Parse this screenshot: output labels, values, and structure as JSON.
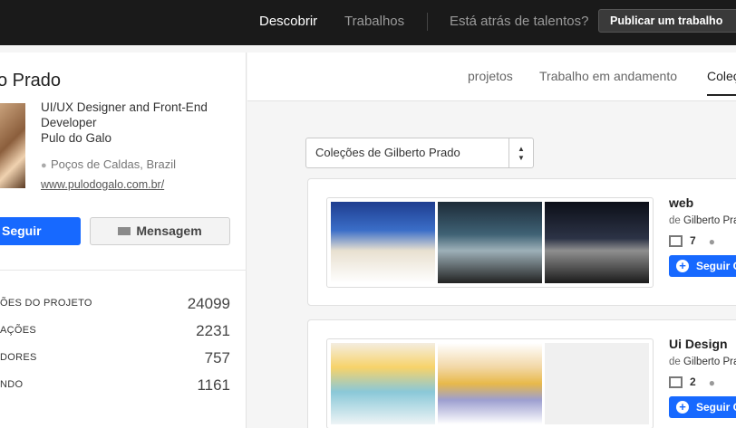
{
  "topbar": {
    "discover": "Descobrir",
    "jobs": "Trabalhos",
    "talent_prompt": "Está atrás de talentos?",
    "publish_job": "Publicar um trabalho"
  },
  "profile": {
    "name": "o Prado",
    "role": "UI/UX Designer and Front-End Developer",
    "company": "Pulo do Galo",
    "location": "Poços de Caldas, Brazil",
    "website": "www.pulodogalo.com.br/",
    "follow_label": "Seguir",
    "message_label": "Mensagem",
    "stats": [
      {
        "label": "ÕES DO PROJETO",
        "value": "24099"
      },
      {
        "label": "AÇÕES",
        "value": "2231"
      },
      {
        "label": "DORES",
        "value": "757"
      },
      {
        "label": "NDO",
        "value": "1161"
      }
    ]
  },
  "tabs": [
    {
      "label": "projetos",
      "active": false
    },
    {
      "label": "Trabalho em andamento",
      "active": false
    },
    {
      "label": "Coleções",
      "active": true
    }
  ],
  "collection_select": {
    "value": "Coleções de Gilberto Prado"
  },
  "collections": [
    {
      "title": "web",
      "by_prefix": "de",
      "by_author": "Gilberto Prado",
      "project_count": "7",
      "follow_label": "Seguir Coleção"
    },
    {
      "title": "Ui Design",
      "by_prefix": "de",
      "by_author": "Gilberto Prado",
      "project_count": "2",
      "follow_label": "Seguir Coleção"
    }
  ],
  "colors": {
    "topbar_bg": "#1a1a1a",
    "brand_blue": "#1769ff"
  }
}
